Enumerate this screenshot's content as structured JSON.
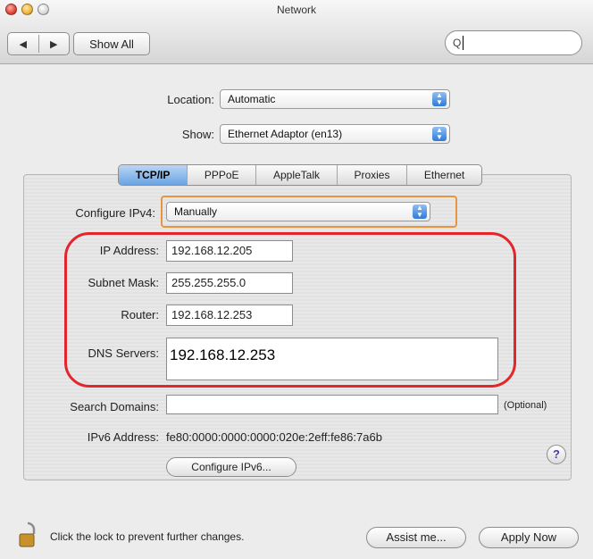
{
  "window": {
    "title": "Network"
  },
  "toolbar": {
    "back_glyph": "◀",
    "forward_glyph": "▶",
    "show_all_label": "Show All",
    "search_glyph": "Q",
    "search_value": ""
  },
  "location": {
    "label": "Location:",
    "value": "Automatic"
  },
  "show": {
    "label": "Show:",
    "value": "Ethernet Adaptor (en13)"
  },
  "tabs": [
    {
      "label": "TCP/IP",
      "active": true
    },
    {
      "label": "PPPoE",
      "active": false
    },
    {
      "label": "AppleTalk",
      "active": false
    },
    {
      "label": "Proxies",
      "active": false
    },
    {
      "label": "Ethernet",
      "active": false
    }
  ],
  "configure_ipv4": {
    "label": "Configure IPv4:",
    "value": "Manually"
  },
  "ip_address": {
    "label": "IP Address:",
    "value": "192.168.12.205"
  },
  "subnet_mask": {
    "label": "Subnet Mask:",
    "value": "255.255.255.0"
  },
  "router": {
    "label": "Router:",
    "value": "192.168.12.253"
  },
  "dns_servers": {
    "label": "DNS Servers:",
    "value": "192.168.12.253"
  },
  "search_domains": {
    "label": "Search Domains:",
    "value": "",
    "optional_note": "(Optional)"
  },
  "ipv6_address": {
    "label": "IPv6 Address:",
    "value": "fe80:0000:0000:0000:020e:2eff:fe86:7a6b"
  },
  "configure_ipv6_button": "Configure IPv6...",
  "help_glyph": "?",
  "lock_text": "Click the lock to prevent further changes.",
  "assist_button": "Assist me...",
  "apply_button": "Apply Now",
  "colors": {
    "highlight_orange": "#e9943f",
    "annotation_red": "#e3262b",
    "tab_blue": "#6aa3e3"
  }
}
